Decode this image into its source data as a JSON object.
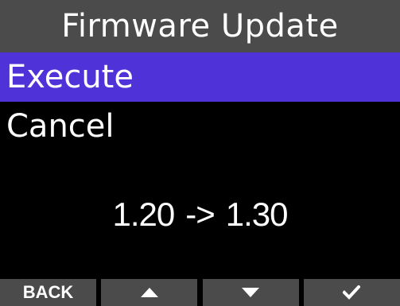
{
  "title": "Firmware Update",
  "menu": {
    "items": [
      {
        "label": "Execute",
        "selected": true
      },
      {
        "label": "Cancel",
        "selected": false
      }
    ]
  },
  "version": {
    "current": "1.20",
    "arrow": "->",
    "new": "1.30"
  },
  "softkeys": {
    "back_label": "BACK",
    "up_icon": "up-triangle-icon",
    "down_icon": "down-triangle-icon",
    "confirm_icon": "checkmark-icon"
  },
  "colors": {
    "title_bar": "#4b4b4b",
    "selection": "#4f33d9",
    "background": "#000000",
    "text": "#ffffff"
  }
}
